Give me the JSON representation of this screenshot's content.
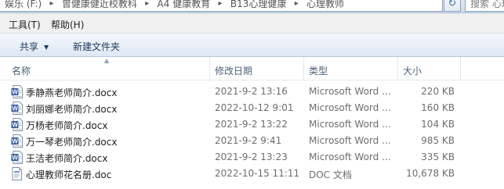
{
  "address_bar": {
    "crumbs": [
      "娱乐 (F:)",
      "曾健康健近校教科",
      "A4 健康教育",
      "B13心理健康",
      "心理教师"
    ],
    "search_placeholder": "搜索 心理..."
  },
  "menu": {
    "items": [
      {
        "label": "工具(T)"
      },
      {
        "label": "帮助(H)"
      }
    ]
  },
  "toolbar": {
    "share_label": "共享",
    "new_folder_label": "新建文件夹"
  },
  "columns": {
    "name": "名称",
    "modified": "修改日期",
    "type": "类型",
    "size": "大小"
  },
  "files": [
    {
      "name": "季静燕老师简介.docx",
      "modified": "2021-9-2 13:16",
      "type": "Microsoft Word ...",
      "size": "220 KB",
      "icon": "word-docx-icon"
    },
    {
      "name": "刘丽娜老师简介.docx",
      "modified": "2022-10-12 9:01",
      "type": "Microsoft Word ...",
      "size": "160 KB",
      "icon": "word-docx-icon"
    },
    {
      "name": "万杨老师简介.docx",
      "modified": "2021-9-2 13:22",
      "type": "Microsoft Word ...",
      "size": "104 KB",
      "icon": "word-docx-icon"
    },
    {
      "name": "万一琴老师简介.docx",
      "modified": "2021-9-2 9:41",
      "type": "Microsoft Word ...",
      "size": "985 KB",
      "icon": "word-docx-icon"
    },
    {
      "name": "王洁老师简介.docx",
      "modified": "2021-9-2 13:23",
      "type": "Microsoft Word ...",
      "size": "335 KB",
      "icon": "word-docx-icon"
    },
    {
      "name": "心理教师花名册.doc",
      "modified": "2022-10-15 11:11",
      "type": "DOC 文档",
      "size": "10,678 KB",
      "icon": "doc-file-icon"
    }
  ],
  "colors": {
    "word_blue": "#2b579a",
    "header_text": "#4c607a",
    "toolbar_text": "#1e3a5f"
  }
}
